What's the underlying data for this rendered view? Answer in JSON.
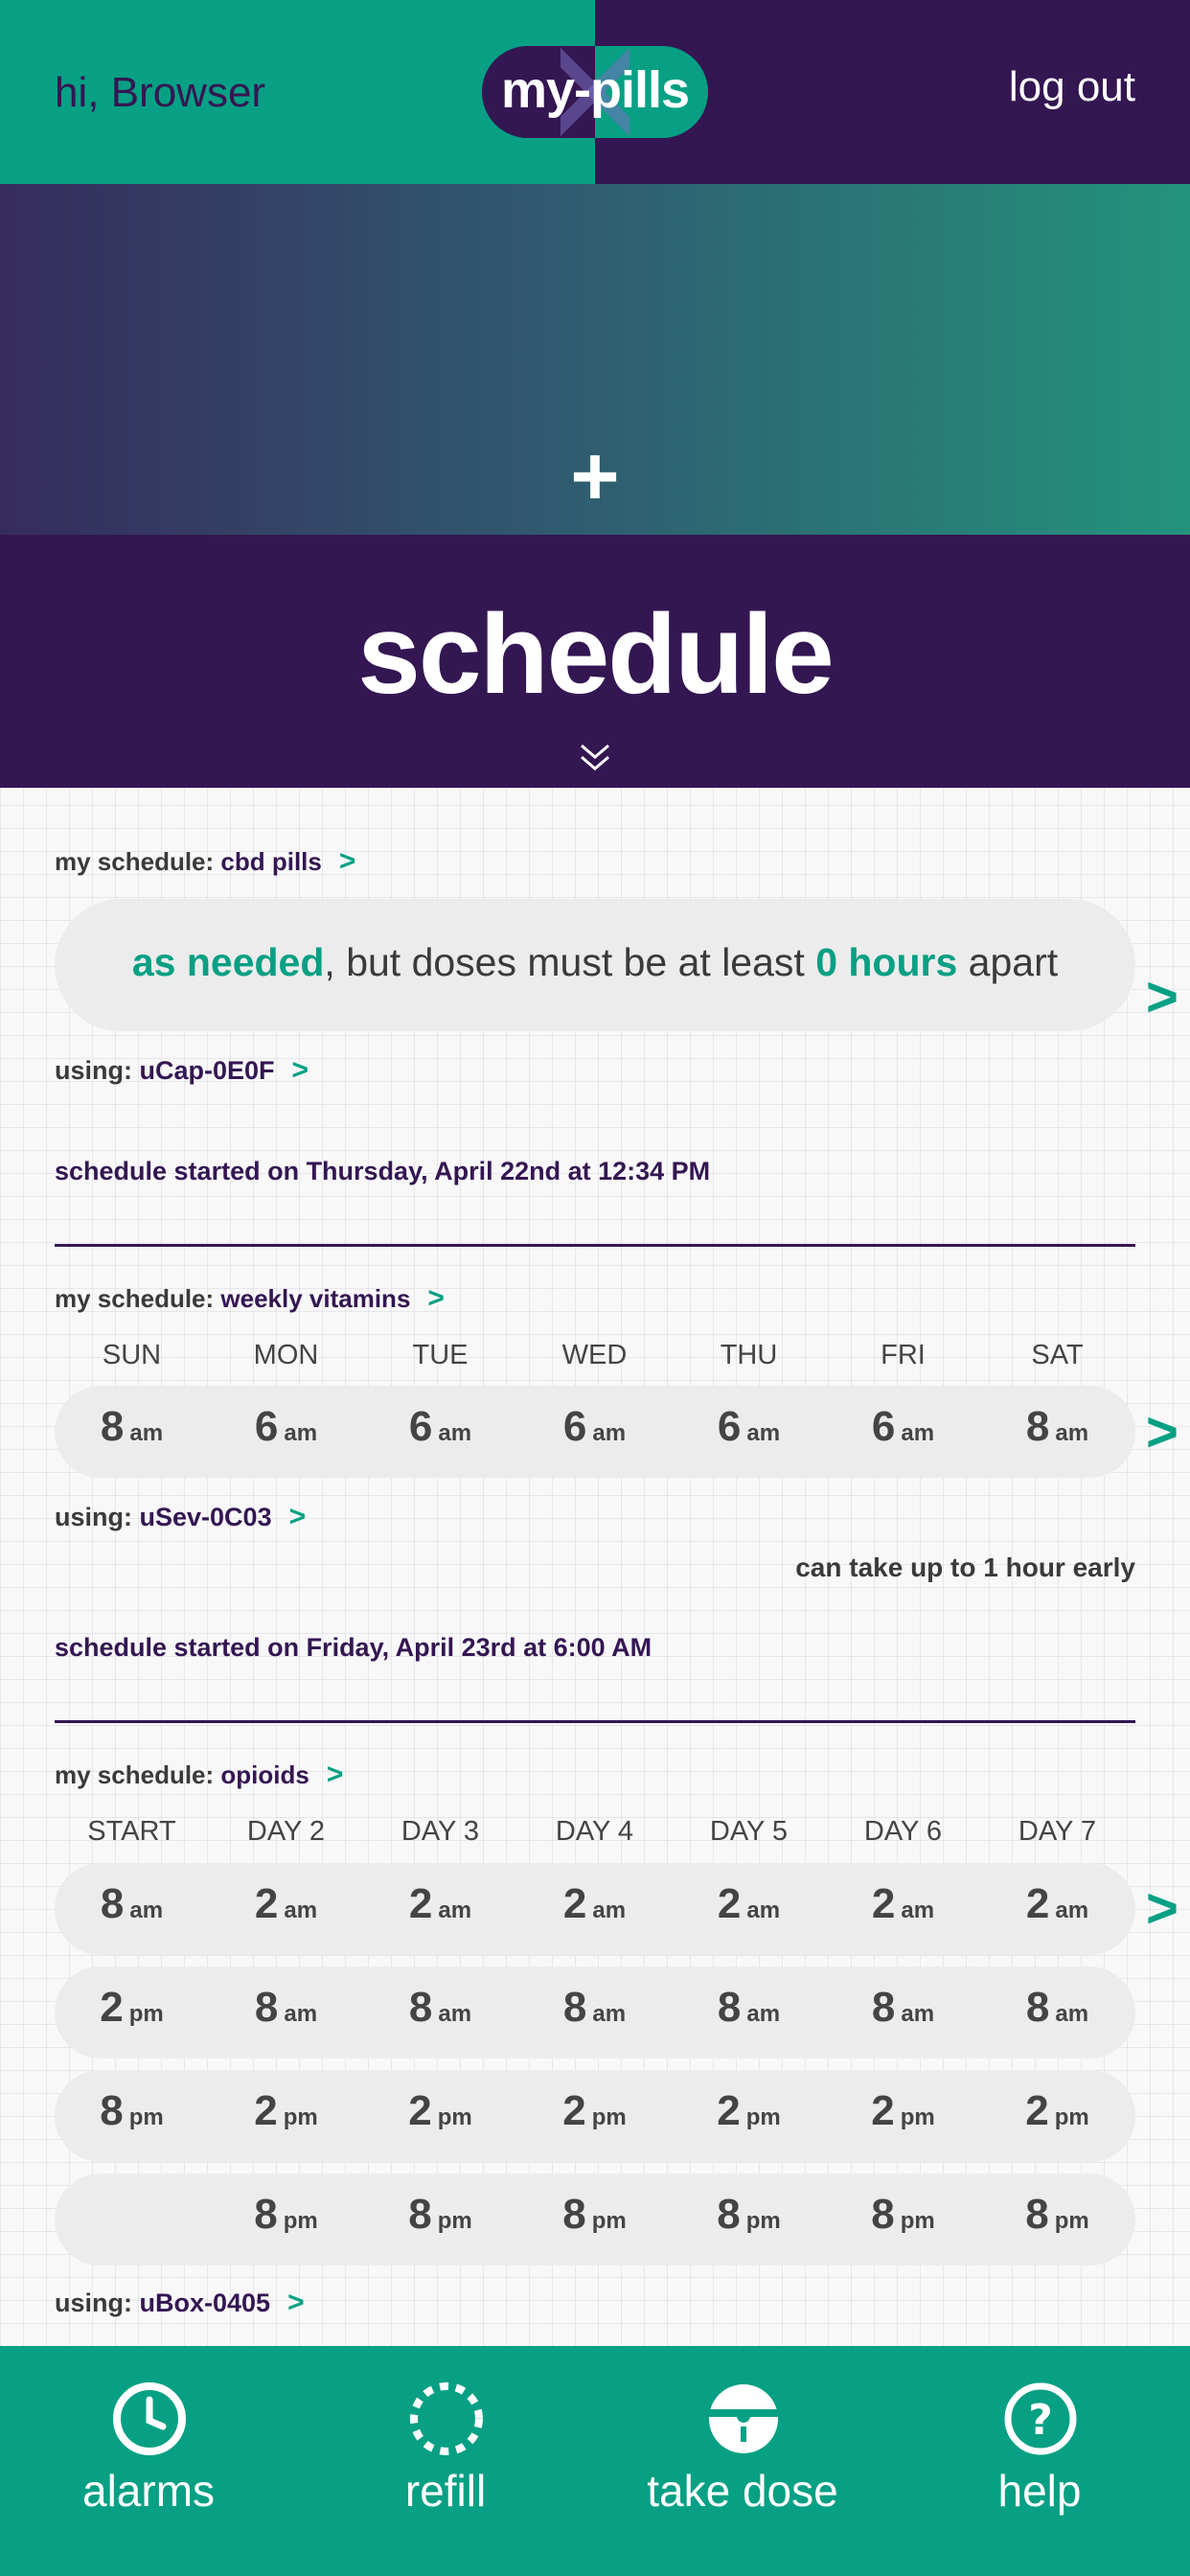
{
  "header": {
    "greeting": "hi, Browser",
    "logo": "my-pills",
    "logout": "log out"
  },
  "hero": {
    "add_symbol": "+"
  },
  "page": {
    "title": "schedule"
  },
  "schedules": [
    {
      "label_prefix": "my schedule:",
      "name": "cbd pills",
      "arrow": ">",
      "as_needed": {
        "lead": "as needed",
        "middle": ", but doses must be at least ",
        "hours": "0 hours",
        "tail": " apart"
      },
      "using_prefix": "using:",
      "device": "uCap-0E0F",
      "started": "schedule started on Thursday, April 22nd at 12:34 PM"
    },
    {
      "label_prefix": "my schedule:",
      "name": "weekly vitamins",
      "arrow": ">",
      "days": [
        "SUN",
        "MON",
        "TUE",
        "WED",
        "THU",
        "FRI",
        "SAT"
      ],
      "rows": [
        [
          {
            "n": "8",
            "u": "am"
          },
          {
            "n": "6",
            "u": "am"
          },
          {
            "n": "6",
            "u": "am"
          },
          {
            "n": "6",
            "u": "am"
          },
          {
            "n": "6",
            "u": "am"
          },
          {
            "n": "6",
            "u": "am"
          },
          {
            "n": "8",
            "u": "am"
          }
        ]
      ],
      "using_prefix": "using:",
      "device": "uSev-0C03",
      "early_note": "can take up to 1 hour early",
      "started": "schedule started on Friday, April 23rd at 6:00 AM"
    },
    {
      "label_prefix": "my schedule:",
      "name": "opioids",
      "arrow": ">",
      "days": [
        "START",
        "DAY 2",
        "DAY 3",
        "DAY 4",
        "DAY 5",
        "DAY 6",
        "DAY 7"
      ],
      "rows": [
        [
          {
            "n": "8",
            "u": "am"
          },
          {
            "n": "2",
            "u": "am"
          },
          {
            "n": "2",
            "u": "am"
          },
          {
            "n": "2",
            "u": "am"
          },
          {
            "n": "2",
            "u": "am"
          },
          {
            "n": "2",
            "u": "am"
          },
          {
            "n": "2",
            "u": "am"
          }
        ],
        [
          {
            "n": "2",
            "u": "pm"
          },
          {
            "n": "8",
            "u": "am"
          },
          {
            "n": "8",
            "u": "am"
          },
          {
            "n": "8",
            "u": "am"
          },
          {
            "n": "8",
            "u": "am"
          },
          {
            "n": "8",
            "u": "am"
          },
          {
            "n": "8",
            "u": "am"
          }
        ],
        [
          {
            "n": "8",
            "u": "pm"
          },
          {
            "n": "2",
            "u": "pm"
          },
          {
            "n": "2",
            "u": "pm"
          },
          {
            "n": "2",
            "u": "pm"
          },
          {
            "n": "2",
            "u": "pm"
          },
          {
            "n": "2",
            "u": "pm"
          },
          {
            "n": "2",
            "u": "pm"
          }
        ],
        [
          {
            "n": "",
            "u": ""
          },
          {
            "n": "8",
            "u": "pm"
          },
          {
            "n": "8",
            "u": "pm"
          },
          {
            "n": "8",
            "u": "pm"
          },
          {
            "n": "8",
            "u": "pm"
          },
          {
            "n": "8",
            "u": "pm"
          },
          {
            "n": "8",
            "u": "pm"
          }
        ]
      ],
      "using_prefix": "using:",
      "device": "uBox-0405"
    }
  ],
  "next_arrow": ">",
  "footer": {
    "items": [
      {
        "label": "alarms",
        "icon": "clock-icon"
      },
      {
        "label": "refill",
        "icon": "dashed-circle-icon"
      },
      {
        "label": "take dose",
        "icon": "pill-lock-icon"
      },
      {
        "label": "help",
        "icon": "question-icon"
      }
    ]
  },
  "colors": {
    "green": "#07a084",
    "purple": "#341652",
    "pill_bg": "#ececec"
  }
}
